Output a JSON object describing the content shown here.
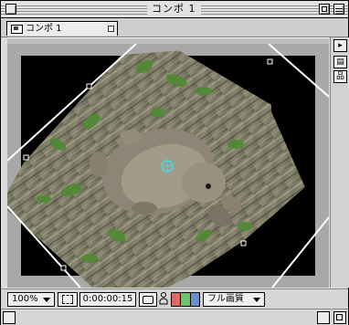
{
  "window": {
    "title": "コンポ 1"
  },
  "tab": {
    "label": "コンポ 1"
  },
  "bottom": {
    "zoom": "100%",
    "timecode": "0:00:00:15",
    "quality": "フル画質"
  },
  "colors": {
    "channel_red": "#d66a6a",
    "channel_green": "#6cc46c",
    "channel_blue": "#6c8ad6",
    "layer_outline": "#ffffff"
  },
  "icons": {
    "close": "close-box-icon",
    "zoom": "zoom-box-icon",
    "collapse": "collapse-box-icon",
    "comp": "composition-icon",
    "region": "region-of-interest-icon",
    "snapshot": "camera-snapshot-icon",
    "person": "show-snapshot-icon",
    "flowchart": "flowchart-icon",
    "menu": "panel-menu-icon"
  }
}
